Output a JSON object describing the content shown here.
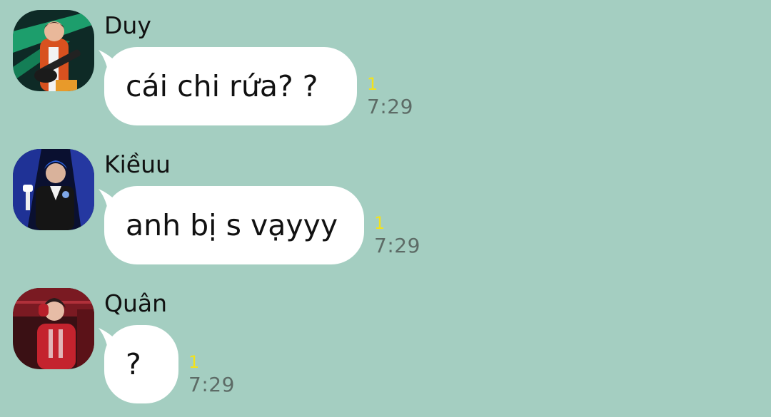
{
  "messages": [
    {
      "sender": "Duy",
      "text": "cái chi rứa? ?",
      "read_count": "1",
      "time": "7:29"
    },
    {
      "sender": "Kiềuu",
      "text": "anh bị s vạyyy",
      "read_count": "1",
      "time": "7:29"
    },
    {
      "sender": "Quân",
      "text": "?",
      "read_count": "1",
      "time": "7:29"
    }
  ],
  "colors": {
    "background": "#a4cec1",
    "bubble": "#ffffff",
    "read_count": "#f3e21a",
    "time": "#5d6b66"
  }
}
